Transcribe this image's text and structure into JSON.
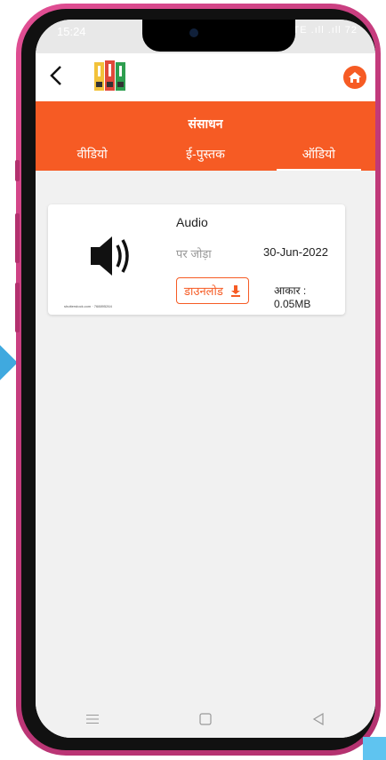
{
  "status_bar": {
    "time": "15:24",
    "icons": "Vo LTE .ıll .ıll 72"
  },
  "app_bar": {
    "back_icon": "chevron-left-icon",
    "logo_icon": "books-logo-icon",
    "home_icon": "home-icon"
  },
  "header": {
    "title": "संसाधन",
    "tabs": [
      {
        "label": "वीडियो",
        "active": false
      },
      {
        "label": "ई-पुस्तक",
        "active": false
      },
      {
        "label": "ऑडियो",
        "active": true
      }
    ]
  },
  "items": [
    {
      "title": "Audio",
      "added_label": "पर जोड़ा",
      "date": "30-Jun-2022",
      "download_label": "डाउनलोड",
      "size_label": "आकार : 0.05MB",
      "thumb_caption": "shutterstock.com · 768895264",
      "thumb_icon": "speaker-icon"
    }
  ],
  "colors": {
    "accent": "#f65b24",
    "frame": "#c23a7b"
  }
}
